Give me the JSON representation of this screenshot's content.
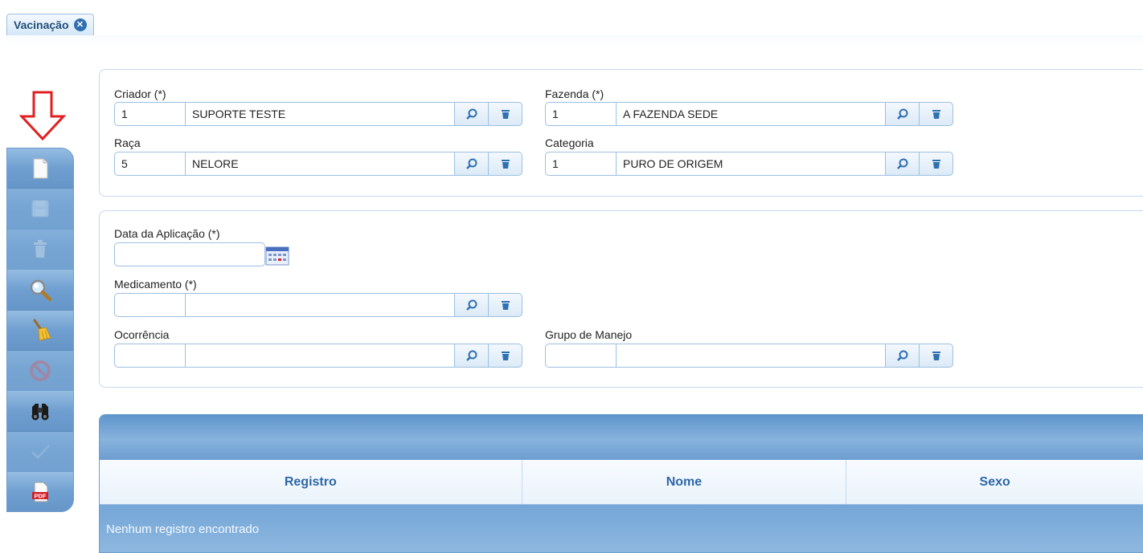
{
  "tab": {
    "label": "Vacinação",
    "close_icon": "close-circle-icon"
  },
  "toolbar": {
    "buttons": [
      {
        "name": "new",
        "icon": "new-document-icon",
        "enabled": true
      },
      {
        "name": "save",
        "icon": "save-disk-icon",
        "enabled": false
      },
      {
        "name": "delete",
        "icon": "trash-icon",
        "enabled": false
      },
      {
        "name": "search",
        "icon": "magnifier-icon",
        "enabled": true
      },
      {
        "name": "clear",
        "icon": "broom-icon",
        "enabled": true
      },
      {
        "name": "cancel",
        "icon": "cancel-icon",
        "enabled": false
      },
      {
        "name": "find",
        "icon": "binoculars-icon",
        "enabled": true
      },
      {
        "name": "confirm",
        "icon": "checkmark-icon",
        "enabled": false
      },
      {
        "name": "pdf",
        "icon": "pdf-icon",
        "enabled": true
      }
    ]
  },
  "filters": {
    "criador": {
      "label": "Criador (*)",
      "code": "1",
      "desc": "SUPORTE TESTE"
    },
    "fazenda": {
      "label": "Fazenda (*)",
      "code": "1",
      "desc": "A FAZENDA SEDE"
    },
    "raca": {
      "label": "Raça",
      "code": "5",
      "desc": "NELORE"
    },
    "categoria": {
      "label": "Categoria",
      "code": "1",
      "desc": "PURO DE ORIGEM"
    }
  },
  "form": {
    "data_aplicacao": {
      "label": "Data da Aplicação (*)",
      "value": ""
    },
    "medicamento": {
      "label": "Medicamento (*)",
      "code": "",
      "desc": ""
    },
    "ocorrencia": {
      "label": "Ocorrência",
      "code": "",
      "desc": ""
    },
    "grupo_manejo": {
      "label": "Grupo de Manejo",
      "code": "",
      "desc": ""
    }
  },
  "grid": {
    "columns": [
      "Registro",
      "Nome",
      "Sexo"
    ],
    "empty_message": "Nenhum registro encontrado"
  },
  "colors": {
    "accent": "#2e67a8",
    "toolbar": "#6f9fd0",
    "arrow": "#e02020"
  }
}
